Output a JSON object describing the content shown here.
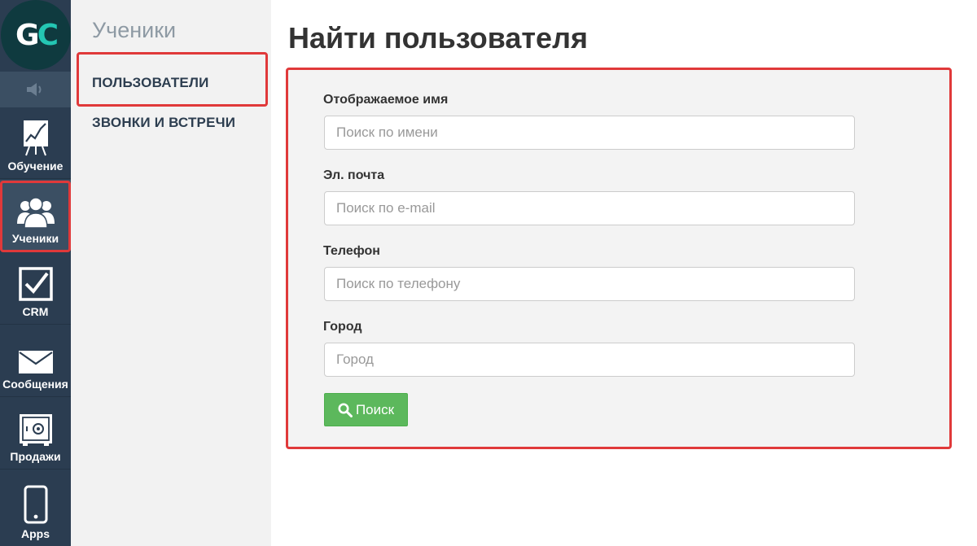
{
  "logo": {
    "letter1": "G",
    "letter2": "C"
  },
  "rail": {
    "items": [
      {
        "label": "Обучение",
        "icon": "chart-board-icon"
      },
      {
        "label": "Ученики",
        "icon": "users-icon"
      },
      {
        "label": "CRM",
        "icon": "checkbox-icon"
      },
      {
        "label": "Сообщения",
        "icon": "envelope-icon"
      },
      {
        "label": "Продажи",
        "icon": "safe-icon"
      },
      {
        "label": "Apps",
        "icon": "phone-icon"
      }
    ],
    "speaker_icon": "speaker-icon"
  },
  "subnav": {
    "title": "Ученики",
    "items": [
      {
        "label": "ПОЛЬЗОВАТЕЛИ"
      },
      {
        "label": "ЗВОНКИ И ВСТРЕЧИ"
      }
    ]
  },
  "main": {
    "title": "Найти пользователя",
    "fields": [
      {
        "label": "Отображаемое имя",
        "placeholder": "Поиск по имени",
        "value": ""
      },
      {
        "label": "Эл. почта",
        "placeholder": "Поиск по e-mail",
        "value": ""
      },
      {
        "label": "Телефон",
        "placeholder": "Поиск по телефону",
        "value": ""
      },
      {
        "label": "Город",
        "placeholder": "Город",
        "value": ""
      }
    ],
    "search_button": "Поиск"
  },
  "colors": {
    "rail_bg": "#2b3d51",
    "highlight": "#e0393a",
    "button": "#5cb85c",
    "logo_accent": "#24c6b3"
  }
}
